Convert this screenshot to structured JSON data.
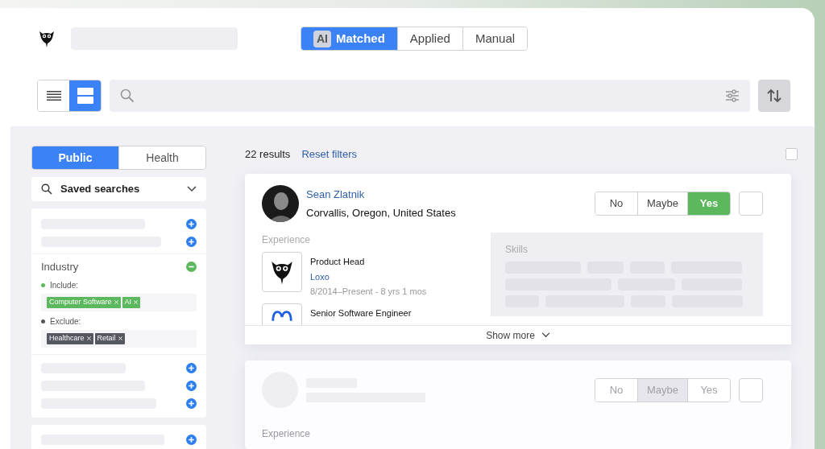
{
  "mode_tabs": [
    {
      "label": "Matched",
      "badge": "AI",
      "selected": true
    },
    {
      "label": "Applied",
      "selected": false
    },
    {
      "label": "Manual",
      "selected": false
    }
  ],
  "view_toggle": [
    {
      "kind": "list",
      "selected": false
    },
    {
      "kind": "cards",
      "selected": true
    }
  ],
  "source_tabs": [
    {
      "label": "Public",
      "selected": true
    },
    {
      "label": "Health",
      "selected": false
    }
  ],
  "saved_searches": {
    "label": "Saved searches"
  },
  "industry_filter": {
    "title": "Industry",
    "expanded": true,
    "include": {
      "label": "Include:",
      "tags": [
        "Computer Software",
        "AI"
      ]
    },
    "exclude": {
      "label": "Exclude:",
      "tags": [
        "Healthcare",
        "Retail"
      ]
    }
  },
  "results": {
    "count": "22 results",
    "reset": "Reset filters",
    "select_all_checked": false
  },
  "candidates": [
    {
      "loading": false,
      "name": "Sean Zlatnik",
      "location": "Corvallis, Oregon, United States",
      "checked": false,
      "decisions": [
        {
          "label": "No",
          "selected": false
        },
        {
          "label": "Maybe",
          "selected": false
        },
        {
          "label": "Yes",
          "selected": true
        }
      ],
      "experience_label": "Experience",
      "experience": [
        {
          "kind": "owl",
          "title": "Product Head",
          "company": "Loxo",
          "dates": "8/2014–Present - 8 yrs 1 mos"
        },
        {
          "kind": "loop",
          "title": "Senior Software Engineer"
        }
      ],
      "skills_label": "Skills",
      "show_more": "Show more"
    },
    {
      "loading": true,
      "checked": false,
      "decisions": [
        {
          "label": "No",
          "selected": false
        },
        {
          "label": "Maybe",
          "selected": true
        },
        {
          "label": "Yes",
          "selected": false
        }
      ],
      "experience_label": "Experience"
    }
  ]
}
